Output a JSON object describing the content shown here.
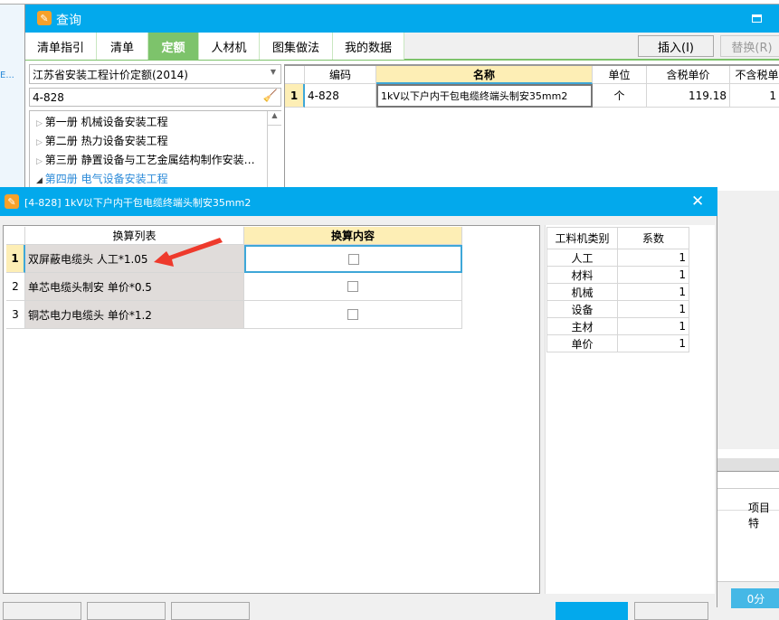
{
  "background": {
    "sidebar_text": "E...",
    "bottom_right_label": "项目特",
    "bottom_right_button": "0分"
  },
  "query_window": {
    "title": "查询",
    "tabs": [
      {
        "label": "清单指引"
      },
      {
        "label": "清单"
      },
      {
        "label": "定额",
        "active": true
      },
      {
        "label": "人材机"
      },
      {
        "label": "图集做法"
      },
      {
        "label": "我的数据"
      }
    ],
    "insert_button": "插入(I)",
    "replace_button": "替换(R)",
    "quota_select": "江苏省安装工程计价定额(2014)",
    "search_value": "4-828",
    "tree": [
      "第一册 机械设备安装工程",
      "第二册 热力设备安装工程",
      "第三册 静置设备与工艺金属结构制作安装…",
      "第四册 电气设备安装工程"
    ],
    "grid": {
      "headers": [
        "编码",
        "名称",
        "单位",
        "含税单价",
        "不含税单"
      ],
      "rows": [
        {
          "num": "1",
          "code": "4-828",
          "name": "1kV以下户内干包电缆终端头制安35mm2",
          "unit": "个",
          "price_tax": "119.18",
          "price_notax": "1"
        }
      ]
    }
  },
  "dialog": {
    "title": "[4-828] 1kV以下户内干包电缆终端头制安35mm2",
    "conv_headers": [
      "换算列表",
      "换算内容"
    ],
    "conv_rows": [
      {
        "num": "1",
        "text": "双屏蔽电缆头 人工*1.05"
      },
      {
        "num": "2",
        "text": "单芯电缆头制安 单价*0.5"
      },
      {
        "num": "3",
        "text": "铜芯电力电缆头 单价*1.2"
      }
    ],
    "coef_headers": [
      "工料机类别",
      "系数"
    ],
    "coef_rows": [
      {
        "type": "人工",
        "value": "1"
      },
      {
        "type": "材料",
        "value": "1"
      },
      {
        "type": "机械",
        "value": "1"
      },
      {
        "type": "设备",
        "value": "1"
      },
      {
        "type": "主材",
        "value": "1"
      },
      {
        "type": "单价",
        "value": "1"
      }
    ]
  },
  "colors": {
    "titlebar": "#03a9ec",
    "active_tab": "#7dc36b",
    "header_highlight": "#fdeeb5",
    "arrow": "#ee3a2c"
  }
}
